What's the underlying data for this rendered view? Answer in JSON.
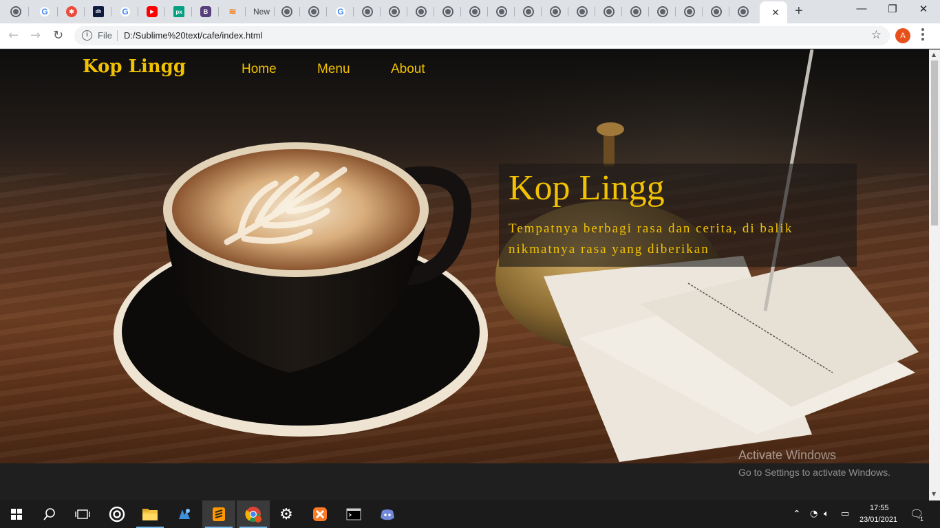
{
  "browser": {
    "tab_labels": [
      "New",
      ""
    ],
    "url_scheme_label": "File",
    "url": "D:/Sublime%20text/cafe/index.html",
    "profile_initial": "A"
  },
  "site": {
    "brand": "Kop Lingg",
    "nav": [
      "Home",
      "Menu",
      "About"
    ],
    "hero_title": "Kop Lingg",
    "hero_text": "Tempatnya berbagi rasa dan cerita, di balik nikmatnya rasa yang diberikan",
    "accent_color": "#f2c200"
  },
  "watermark": {
    "line1": "Activate Windows",
    "line2": "Go to Settings to activate Windows."
  },
  "taskbar": {
    "time": "17:55",
    "date": "23/01/2021",
    "notification_count": "1"
  }
}
